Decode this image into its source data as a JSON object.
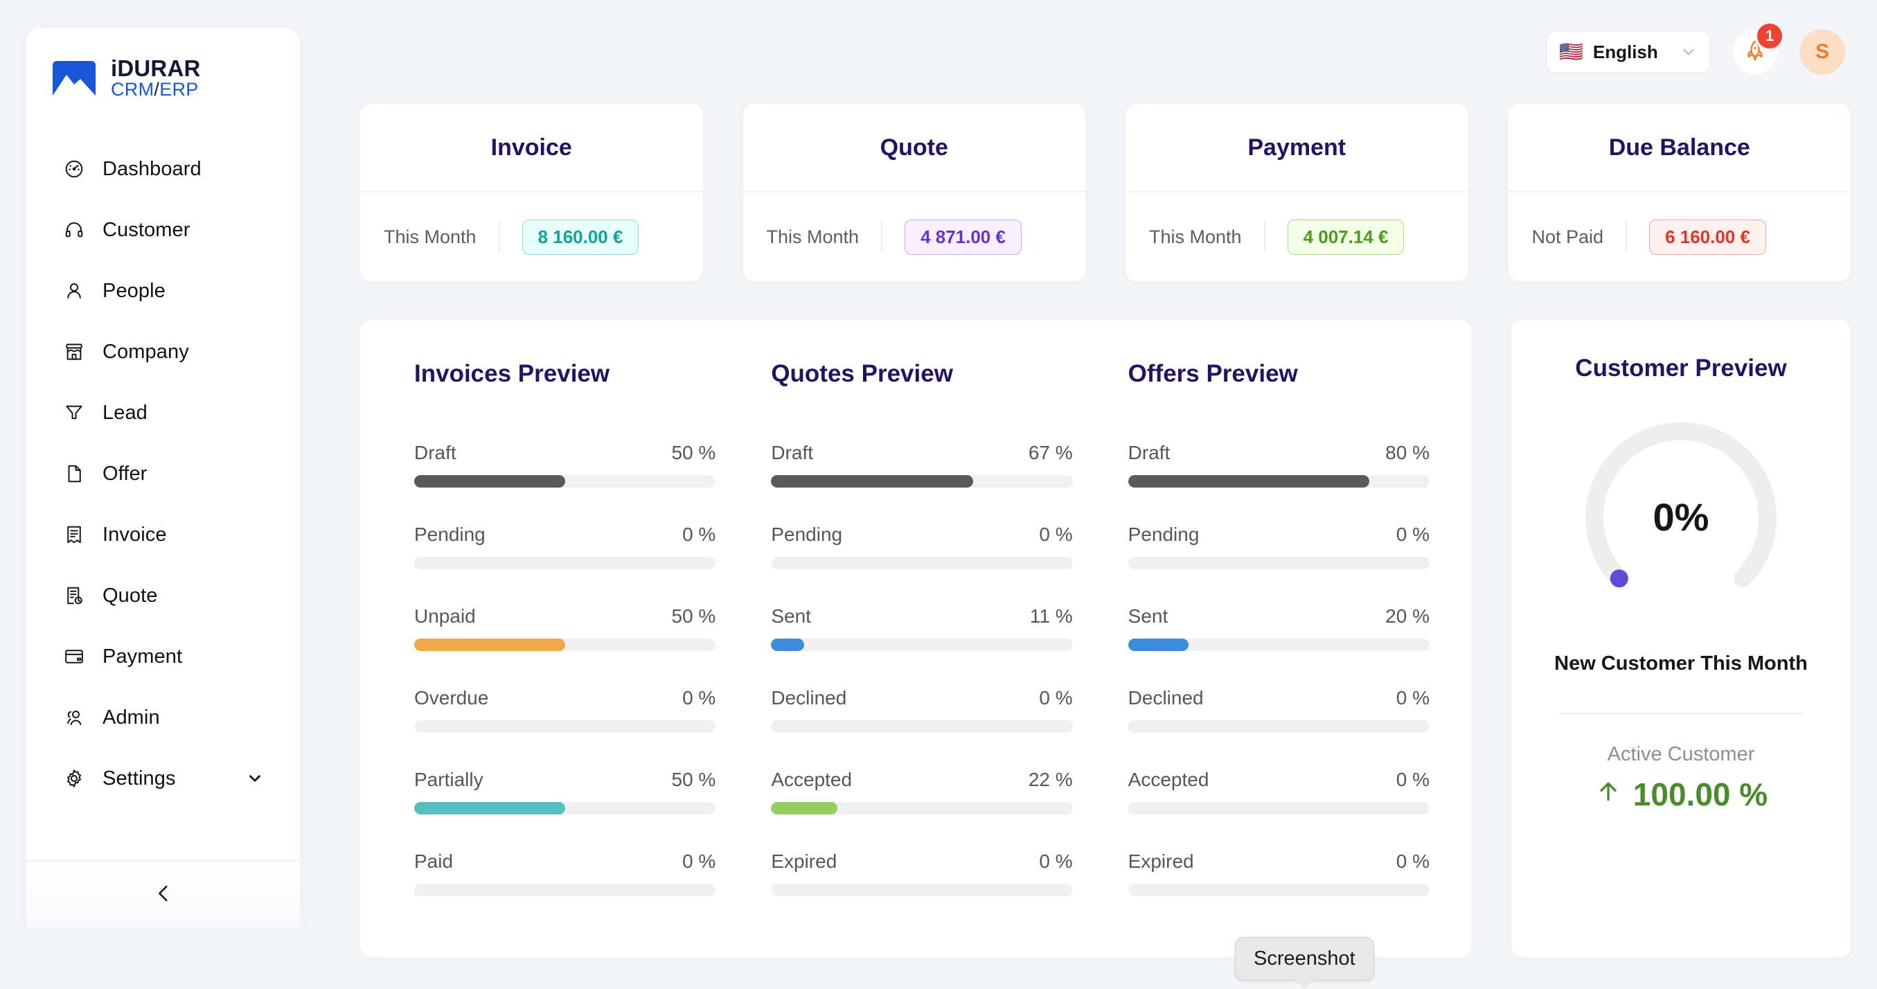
{
  "brand": {
    "name_top": "iDURAR",
    "name_bottom_primary": "CRM",
    "name_bottom_sep": "/",
    "name_bottom_secondary": "ERP"
  },
  "sidebar": {
    "items": [
      {
        "label": "Dashboard",
        "icon": "speedometer-icon"
      },
      {
        "label": "Customer",
        "icon": "headset-icon"
      },
      {
        "label": "People",
        "icon": "person-icon"
      },
      {
        "label": "Company",
        "icon": "storefront-icon"
      },
      {
        "label": "Lead",
        "icon": "funnel-icon"
      },
      {
        "label": "Offer",
        "icon": "file-icon"
      },
      {
        "label": "Invoice",
        "icon": "receipt-icon"
      },
      {
        "label": "Quote",
        "icon": "document-sync-icon"
      },
      {
        "label": "Payment",
        "icon": "credit-card-icon"
      },
      {
        "label": "Admin",
        "icon": "people-icon"
      },
      {
        "label": "Settings",
        "icon": "gear-icon",
        "expandable": true
      }
    ],
    "collapse_icon": "chevron-left-icon"
  },
  "header": {
    "language": "English",
    "language_flag": "🇺🇸",
    "caret_icon": "chevron-down-icon",
    "notification_icon": "rocket-icon",
    "notification_count": "1",
    "avatar_initial": "S"
  },
  "stats": [
    {
      "title": "Invoice",
      "label": "This Month",
      "value": "8 160.00 €",
      "color": "#11a39a",
      "bg": "#e6fffb",
      "border": "#8ee0d8"
    },
    {
      "title": "Quote",
      "label": "This Month",
      "value": "4 871.00 €",
      "color": "#6a2fd0",
      "bg": "#f8f0ff",
      "border": "#cdaaf2"
    },
    {
      "title": "Payment",
      "label": "This Month",
      "value": "4 007.14 €",
      "color": "#4c9a1f",
      "bg": "#f4ffe8",
      "border": "#addb7e"
    },
    {
      "title": "Due Balance",
      "label": "Not Paid",
      "value": "6 160.00 €",
      "color": "#e0352b",
      "bg": "#fff1f0",
      "border": "#f5a6a0"
    }
  ],
  "previews": [
    {
      "title": "Invoices Preview",
      "rows": [
        {
          "name": "Draft",
          "percent": "50 %",
          "value": 50,
          "color": "#595959"
        },
        {
          "name": "Pending",
          "percent": "0 %",
          "value": 0,
          "color": "#595959"
        },
        {
          "name": "Unpaid",
          "percent": "50 %",
          "value": 50,
          "color": "#f0a64b"
        },
        {
          "name": "Overdue",
          "percent": "0 %",
          "value": 0,
          "color": "#f0a64b"
        },
        {
          "name": "Partially",
          "percent": "50 %",
          "value": 50,
          "color": "#56bfbf"
        },
        {
          "name": "Paid",
          "percent": "0 %",
          "value": 0,
          "color": "#56bfbf"
        }
      ]
    },
    {
      "title": "Quotes Preview",
      "rows": [
        {
          "name": "Draft",
          "percent": "67 %",
          "value": 67,
          "color": "#595959"
        },
        {
          "name": "Pending",
          "percent": "0 %",
          "value": 0,
          "color": "#595959"
        },
        {
          "name": "Sent",
          "percent": "11 %",
          "value": 11,
          "color": "#3d8bde"
        },
        {
          "name": "Declined",
          "percent": "0 %",
          "value": 0,
          "color": "#3d8bde"
        },
        {
          "name": "Accepted",
          "percent": "22 %",
          "value": 22,
          "color": "#95ce5f"
        },
        {
          "name": "Expired",
          "percent": "0 %",
          "value": 0,
          "color": "#95ce5f"
        }
      ]
    },
    {
      "title": "Offers Preview",
      "rows": [
        {
          "name": "Draft",
          "percent": "80 %",
          "value": 80,
          "color": "#595959"
        },
        {
          "name": "Pending",
          "percent": "0 %",
          "value": 0,
          "color": "#595959"
        },
        {
          "name": "Sent",
          "percent": "20 %",
          "value": 20,
          "color": "#3d8bde"
        },
        {
          "name": "Declined",
          "percent": "0 %",
          "value": 0,
          "color": "#3d8bde"
        },
        {
          "name": "Accepted",
          "percent": "0 %",
          "value": 0,
          "color": "#95ce5f"
        },
        {
          "name": "Expired",
          "percent": "0 %",
          "value": 0,
          "color": "#95ce5f"
        }
      ]
    }
  ],
  "customer_preview": {
    "title": "Customer Preview",
    "gauge_value": "0%",
    "gauge_percent": 0,
    "caption": "New Customer This Month",
    "active_label": "Active Customer",
    "active_icon": "arrow-up-icon",
    "active_value": "100.00 %",
    "active_color": "#4b8b2b"
  },
  "tooltip": {
    "text": "Screenshot"
  }
}
